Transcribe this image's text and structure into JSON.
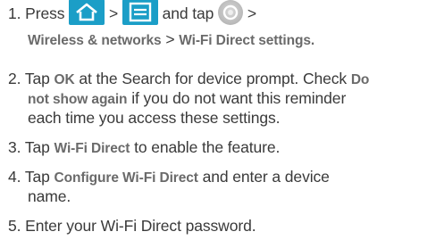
{
  "steps": [
    {
      "num": "1.",
      "press": "Press",
      "gt1": ">",
      "and_tap": "and tap",
      "gt2": ">",
      "path_a": "Wireless & networks",
      "path_sep": " > ",
      "path_b": "Wi-Fi Direct settings."
    },
    {
      "num": "2.",
      "t1": "Tap",
      "b1": "OK",
      "t2": "at the Search for device prompt. Check",
      "b2a": "Do",
      "b2b": "not show again",
      "t3": "if you do not want this reminder",
      "t4": "each time you access these settings."
    },
    {
      "num": "3.",
      "t1": "Tap",
      "b1": "Wi-Fi Direct",
      "t2": "to enable the feature."
    },
    {
      "num": "4.",
      "t1": "Tap",
      "b1": "Configure Wi-Fi Direct",
      "t2": "and enter a device",
      "t3": "name."
    },
    {
      "num": "5.",
      "t1": "Enter your Wi-Fi Direct password."
    }
  ],
  "icons": {
    "home": "home-icon",
    "menu": "menu-icon",
    "settings": "settings-icon",
    "accent_color": "#1b9ec7"
  }
}
